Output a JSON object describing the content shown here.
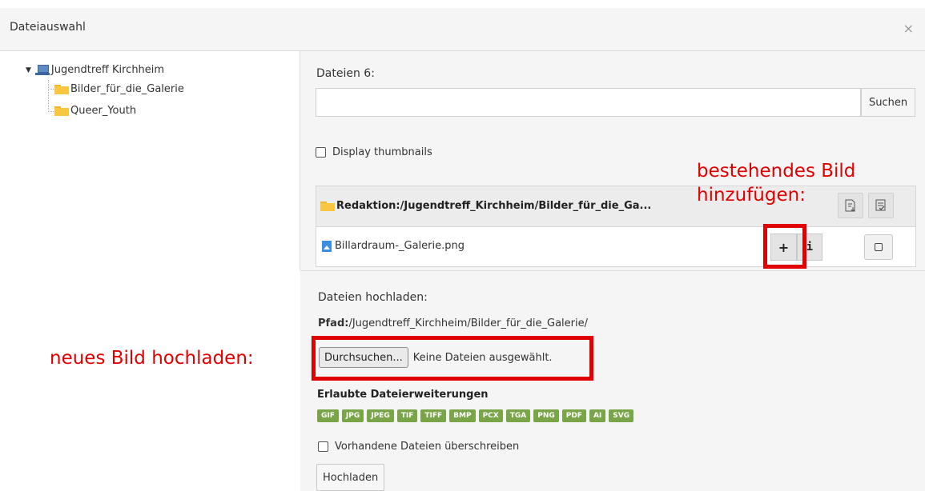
{
  "dialog": {
    "title": "Dateiauswahl",
    "close_glyph": "×"
  },
  "tree": {
    "root_label": "Jugendtreff Kirchheim",
    "children": [
      "Bilder_für_die_Galerie",
      "Queer_Youth"
    ]
  },
  "files": {
    "count_label": "Dateien 6:",
    "search_value": "",
    "search_button": "Suchen",
    "thumbnails_label": "Display thumbnails",
    "thumbnails_checked": false,
    "path_header": "Redaktion:/Jugendtreff_Kirchheim/Bilder_für_die_Ga...",
    "rows": [
      {
        "name": "Billardraum-_Galerie.png",
        "add_glyph": "+",
        "info_glyph": "i"
      }
    ]
  },
  "upload": {
    "title": "Dateien hochladen:",
    "path_label": "Pfad:",
    "path_value": "/Jugendtreff_Kirchheim/Bilder_für_die_Galerie/",
    "browse_button": "Durchsuchen...",
    "browse_status": "Keine Dateien ausgewählt.",
    "extensions_title": "Erlaubte Dateierweiterungen",
    "extensions": [
      "GIF",
      "JPG",
      "JPEG",
      "TIF",
      "TIFF",
      "BMP",
      "PCX",
      "TGA",
      "PNG",
      "PDF",
      "AI",
      "SVG"
    ],
    "overwrite_label": "Vorhandene Dateien überschreiben",
    "overwrite_checked": false,
    "upload_button": "Hochladen"
  },
  "annotations": {
    "existing_image_line1": "bestehendes Bild",
    "existing_image_line2": "hinzufügen:",
    "new_image": "neues Bild hochladen:",
    "highlight_color": "#e00000"
  },
  "colors": {
    "folder": "#f9c642",
    "extension_badge": "#79a548",
    "image_icon": "#3b8ee0"
  }
}
